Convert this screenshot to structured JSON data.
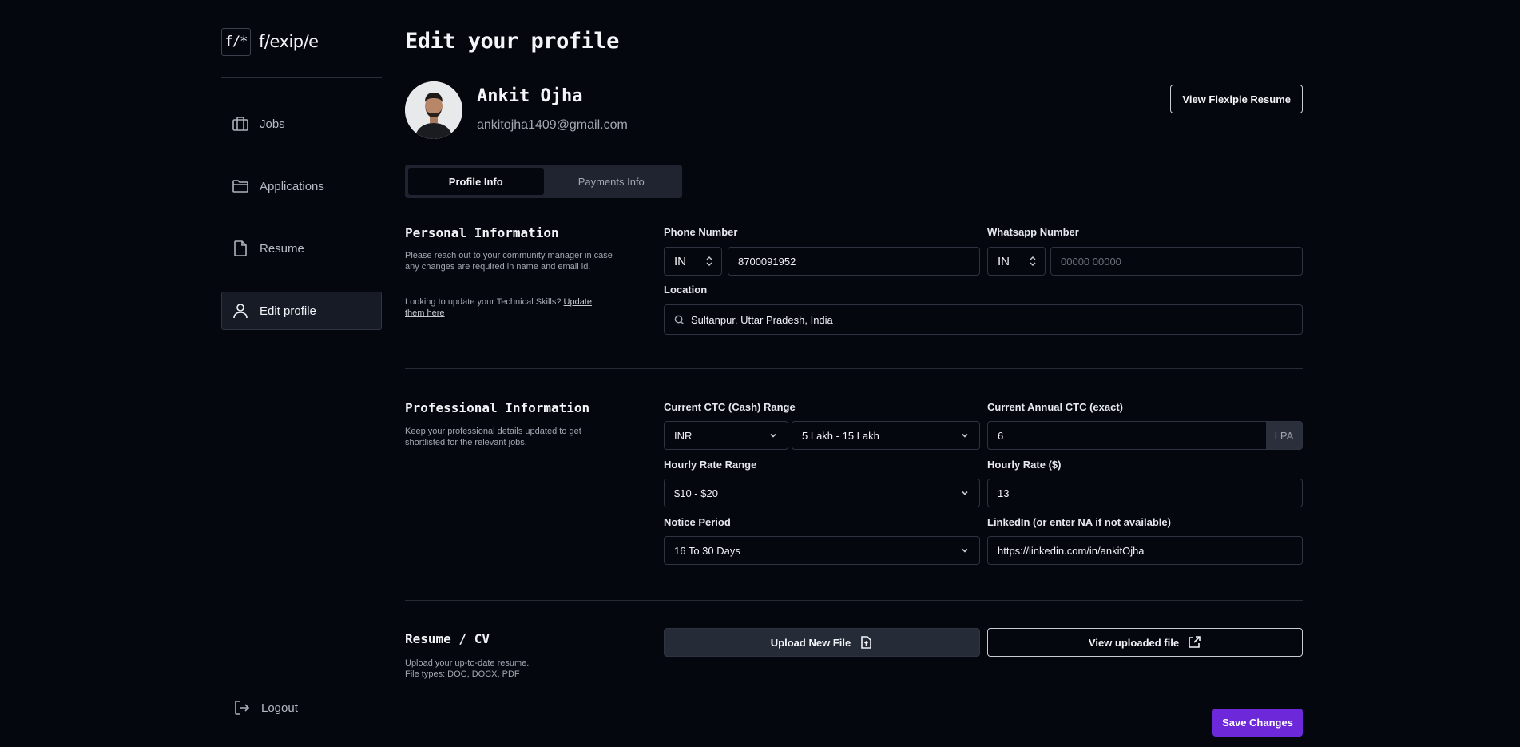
{
  "brand": {
    "mark": "f/*",
    "name": "f/exip/e"
  },
  "sidebar": {
    "items": [
      {
        "label": "Jobs",
        "icon": "briefcase-icon"
      },
      {
        "label": "Applications",
        "icon": "folder-icon"
      },
      {
        "label": "Resume",
        "icon": "document-icon"
      },
      {
        "label": "Edit profile",
        "icon": "user-icon",
        "active": true
      }
    ],
    "logout_label": "Logout"
  },
  "page": {
    "title": "Edit your profile"
  },
  "profile": {
    "name": "Ankit Ojha",
    "email": "ankitojha1409@gmail.com",
    "view_resume_label": "View Flexiple Resume"
  },
  "tabs": [
    {
      "label": "Profile Info",
      "active": true
    },
    {
      "label": "Payments Info",
      "active": false
    }
  ],
  "personal": {
    "title": "Personal Information",
    "desc": "Please reach out to your community manager in case any changes are required in name and email id.",
    "skills_prompt": "Looking to update your Technical Skills?",
    "skills_link": "Update them here",
    "phone_label": "Phone Number",
    "phone_country": "IN",
    "phone_value": "8700091952",
    "whatsapp_label": "Whatsapp Number",
    "whatsapp_country": "IN",
    "whatsapp_placeholder": "00000 00000",
    "location_label": "Location",
    "location_value": "Sultanpur, Uttar Pradesh, India"
  },
  "professional": {
    "title": "Professional Information",
    "desc": "Keep your professional details updated to get shortlisted for the relevant jobs.",
    "ctc_range_label": "Current CTC (Cash) Range",
    "ctc_currency": "INR",
    "ctc_range": "5 Lakh - 15 Lakh",
    "ctc_exact_label": "Current Annual CTC (exact)",
    "ctc_exact": "6",
    "ctc_unit": "LPA",
    "hourly_range_label": "Hourly Rate Range",
    "hourly_range": "$10 - $20",
    "hourly_rate_label": "Hourly Rate ($)",
    "hourly_rate": "13",
    "notice_label": "Notice Period",
    "notice": "16 To 30 Days",
    "linkedin_label": "LinkedIn (or enter NA if not available)",
    "linkedin": "https://linkedin.com/in/ankitOjha"
  },
  "resume": {
    "title": "Resume / CV",
    "desc": "Upload your up-to-date resume.",
    "types": "File types: DOC, DOCX, PDF",
    "upload_label": "Upload New File",
    "view_label": "View uploaded file"
  },
  "save_label": "Save Changes",
  "colors": {
    "background": "#05070f",
    "accent": "#6d28d9",
    "surface": "#1f2430"
  }
}
